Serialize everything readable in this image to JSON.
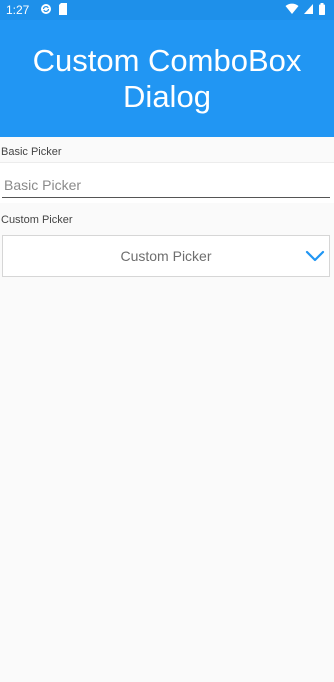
{
  "status_bar": {
    "time": "1:27",
    "left_icons": [
      "sync-icon",
      "sd-card-icon"
    ],
    "right_icons": [
      "wifi-icon",
      "signal-icon",
      "battery-icon"
    ],
    "color": "#1e90ea"
  },
  "header": {
    "title": "Custom ComboBox Dialog",
    "color": "#2196f3"
  },
  "basic_picker": {
    "label": "Basic Picker",
    "placeholder": "Basic Picker"
  },
  "custom_picker": {
    "label": "Custom Picker",
    "value": "Custom Picker",
    "chevron_icon": "chevron-down-icon",
    "accent": "#2196f3"
  }
}
